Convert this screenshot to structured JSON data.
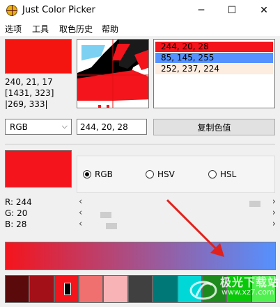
{
  "window": {
    "title": "Just Color Picker",
    "icon": "crosshair-app-icon",
    "controls": {
      "minimize": "─",
      "maximize": "☐",
      "close": "✕"
    }
  },
  "menu": {
    "items": [
      "选项",
      "工具",
      "取色历史",
      "帮助"
    ]
  },
  "current": {
    "color_hex": "#f41511",
    "rgb_text": "240, 21, 17",
    "screen_coords": "[1431, 323]",
    "window_coords": "|269, 333|"
  },
  "history": [
    {
      "text": "244, 20, 28",
      "color": "#f4141c",
      "text_color": "#000000"
    },
    {
      "text": "85, 145, 255",
      "color": "#5591ff",
      "text_color": "#000000"
    },
    {
      "text": "252, 237, 224",
      "color": "#fcede0",
      "text_color": "#000000"
    }
  ],
  "format": {
    "selected": "RGB",
    "arrow": "⌵"
  },
  "value_field": {
    "value": "244, 20, 28"
  },
  "copy_button": {
    "label": "复制色值"
  },
  "editor": {
    "swatch_color": "#f4141c",
    "modes": [
      {
        "label": "RGB",
        "checked": true
      },
      {
        "label": "HSV",
        "checked": false
      },
      {
        "label": "HSL",
        "checked": false
      }
    ],
    "channels": [
      {
        "label": "R: 244",
        "level": 0.957
      },
      {
        "label": "G: 20",
        "level": 0.078
      },
      {
        "label": "B: 28",
        "level": 0.11
      }
    ]
  },
  "gradient": {
    "from": "#f4141c",
    "to": "#5591ff"
  },
  "palette": [
    "#5a0a0a",
    "#a31018",
    "#f4141c",
    "#f07070",
    "#f7b3b6",
    "#404040",
    "#007878",
    "#00d8d8",
    "#1e8a1e",
    "#08c808",
    "#50f050"
  ],
  "watermark": {
    "brand": "极光下载站",
    "url": "www.xz7.com"
  },
  "annotation": {
    "color": "#e0211c"
  }
}
